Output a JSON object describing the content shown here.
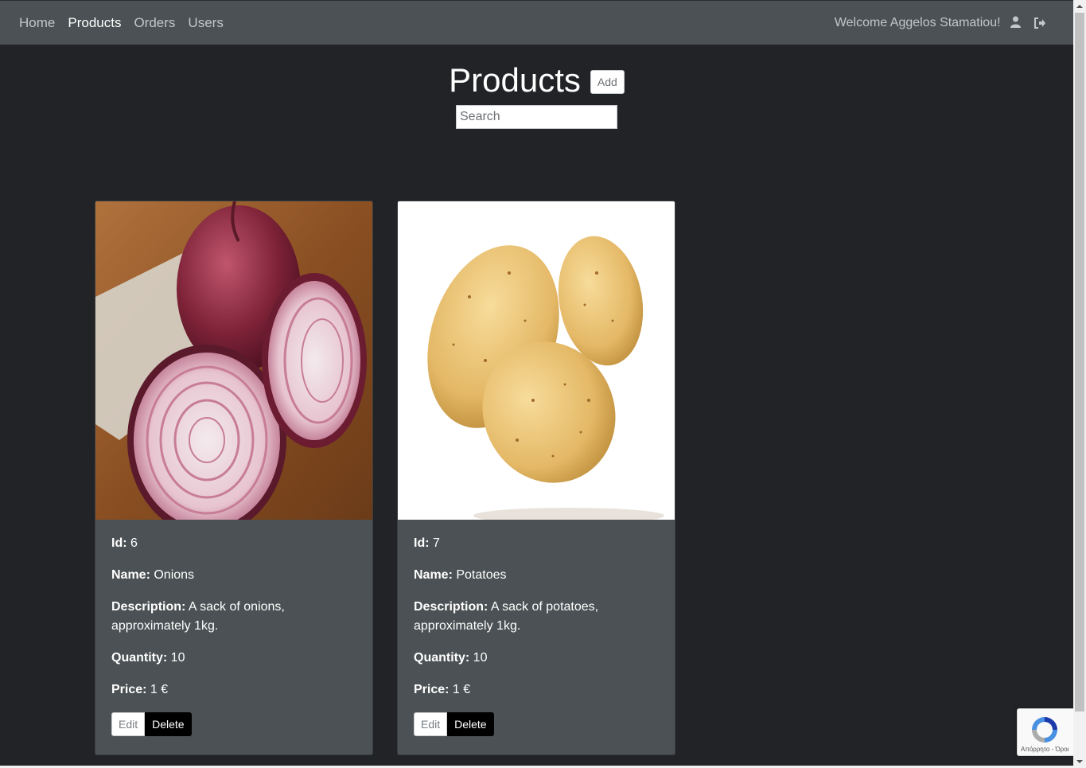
{
  "nav": {
    "links": [
      "Home",
      "Products",
      "Orders",
      "Users"
    ],
    "active": "Products",
    "welcome": "Welcome Aggelos Stamatiou!"
  },
  "header": {
    "title": "Products",
    "add_label": "Add",
    "search_placeholder": "Search"
  },
  "labels": {
    "id": "Id:",
    "name": "Name:",
    "description": "Description:",
    "quantity": "Quantity:",
    "price": "Price:",
    "edit": "Edit",
    "delete": "Delete"
  },
  "products": [
    {
      "id": "6",
      "name": "Onions",
      "description": "A sack of onions, approximately 1kg.",
      "quantity": "10",
      "price": "1 €",
      "image": "onion-photo"
    },
    {
      "id": "7",
      "name": "Potatoes",
      "description": "A sack of potatoes, approximately 1kg.",
      "quantity": "10",
      "price": "1 €",
      "image": "potato-photo"
    }
  ],
  "recaptcha": {
    "text": "Απόρρητο - Όροι"
  },
  "colors": {
    "navbar": "#4b5154",
    "background": "#212327",
    "card": "#4b5154",
    "delete_button": "#000000"
  }
}
